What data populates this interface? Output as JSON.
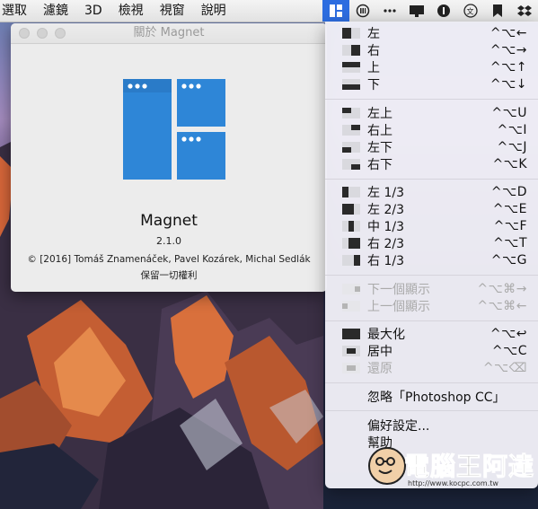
{
  "menubar": {
    "items": [
      "選取",
      "濾鏡",
      "3D",
      "檢視",
      "視窗",
      "說明"
    ]
  },
  "status_icons": [
    "magnet-icon",
    "dashboard-icon",
    "more-icon",
    "display-icon",
    "info-icon",
    "translate-icon",
    "bookmark-icon",
    "dropbox-icon"
  ],
  "about": {
    "window_title": "關於 Magnet",
    "app_name": "Magnet",
    "version": "2.1.0",
    "copyright": "© [2016] Tomáš Znamenáček, Pavel Kozárek, Michal Sedlák",
    "rights": "保留一切權利",
    "logo_color": "#2e86d7"
  },
  "menu": {
    "halves": [
      {
        "label": "左",
        "shortcut": "^⌥←",
        "icon": "left-half-icon"
      },
      {
        "label": "右",
        "shortcut": "^⌥→",
        "icon": "right-half-icon"
      },
      {
        "label": "上",
        "shortcut": "^⌥↑",
        "icon": "top-half-icon"
      },
      {
        "label": "下",
        "shortcut": "^⌥↓",
        "icon": "bottom-half-icon"
      }
    ],
    "quarters": [
      {
        "label": "左上",
        "shortcut": "^⌥U",
        "icon": "top-left-icon"
      },
      {
        "label": "右上",
        "shortcut": "^⌥I",
        "icon": "top-right-icon"
      },
      {
        "label": "左下",
        "shortcut": "^⌥J",
        "icon": "bottom-left-icon"
      },
      {
        "label": "右下",
        "shortcut": "^⌥K",
        "icon": "bottom-right-icon"
      }
    ],
    "thirds": [
      {
        "label": "左 1/3",
        "shortcut": "^⌥D",
        "icon": "left-third-icon"
      },
      {
        "label": "左 2/3",
        "shortcut": "^⌥E",
        "icon": "left-two-thirds-icon"
      },
      {
        "label": "中 1/3",
        "shortcut": "^⌥F",
        "icon": "center-third-icon"
      },
      {
        "label": "右 2/3",
        "shortcut": "^⌥T",
        "icon": "right-two-thirds-icon"
      },
      {
        "label": "右 1/3",
        "shortcut": "^⌥G",
        "icon": "right-third-icon"
      }
    ],
    "displays": [
      {
        "label": "下一個顯示",
        "shortcut": "^⌥⌘→",
        "icon": "next-display-icon"
      },
      {
        "label": "上一個顯示",
        "shortcut": "^⌥⌘←",
        "icon": "previous-display-icon"
      }
    ],
    "window": [
      {
        "label": "最大化",
        "shortcut": "^⌥↩",
        "icon": "maximize-icon"
      },
      {
        "label": "居中",
        "shortcut": "^⌥C",
        "icon": "center-icon"
      },
      {
        "label": "還原",
        "shortcut": "^⌥⌫",
        "icon": "restore-icon"
      }
    ],
    "ignore": "忽略「Photoshop CC」",
    "preferences": "偏好設定...",
    "help": "幫助"
  },
  "watermark": {
    "text": "電腦王阿達",
    "url": "http://www.kocpc.com.tw"
  }
}
